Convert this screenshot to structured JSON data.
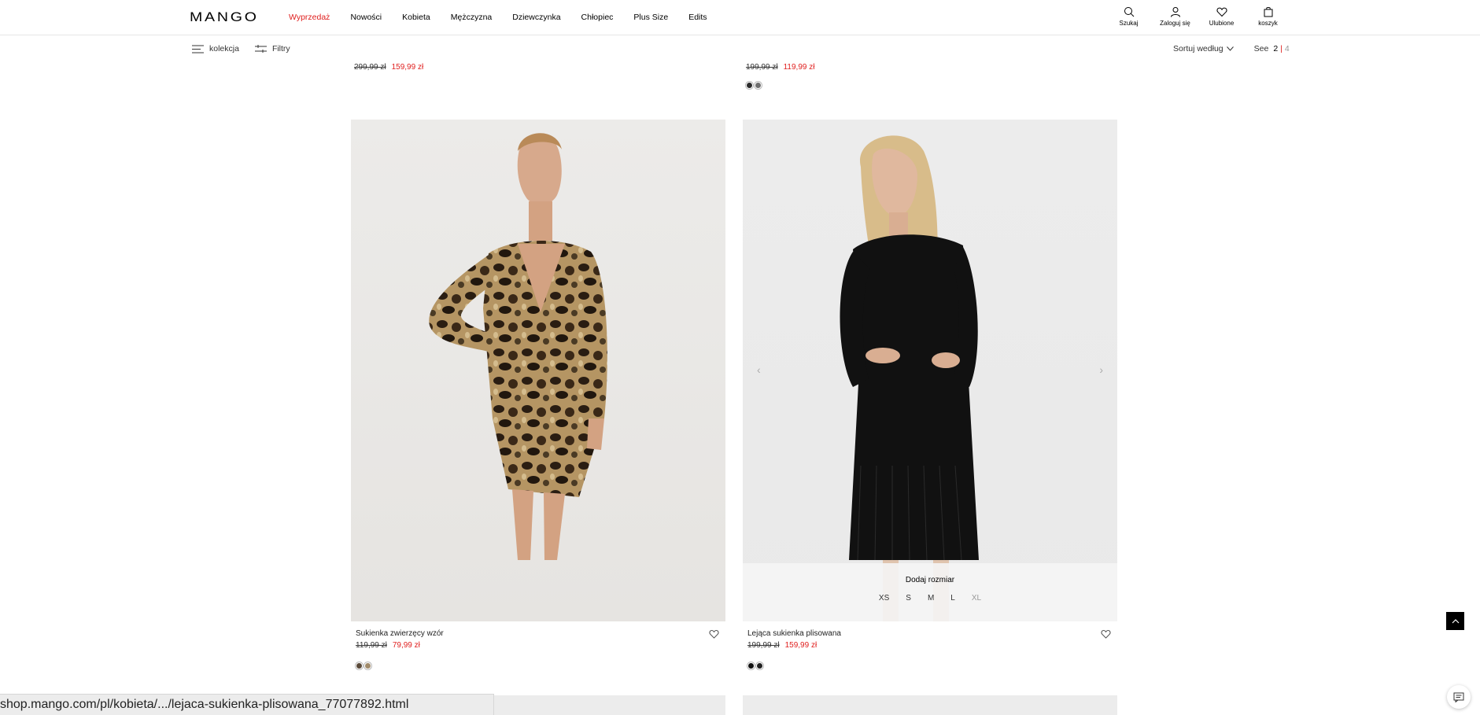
{
  "header": {
    "logo": "MANGO",
    "nav": [
      "Wyprzedaż",
      "Nowości",
      "Kobieta",
      "Mężczyzna",
      "Dziewczynka",
      "Chłopiec",
      "Plus Size",
      "Edits"
    ],
    "icons": {
      "search": "Szukaj",
      "login": "Zaloguj się",
      "favorites": "Ulubione",
      "cart": "koszyk"
    }
  },
  "toolbar": {
    "collection": "kolekcja",
    "filters": "Filtry",
    "sort": "Sortuj według",
    "see_label": "See",
    "see_option_2": "2",
    "see_separator": "|",
    "see_option_4": "4"
  },
  "top_row": [
    {
      "old_price": "299,99 zł",
      "new_price": "159,99 zł",
      "swatches": []
    },
    {
      "old_price": "199,99 zł",
      "new_price": "119,99 zł",
      "swatches": [
        "#2b2b2b",
        "#6e6e6e"
      ]
    }
  ],
  "products": [
    {
      "name": "Sukienka zwierzęcy wzór",
      "old_price": "119,99 zł",
      "new_price": "79,99 zł",
      "swatches": [
        "#5a4a3a",
        "#a08a6a"
      ]
    },
    {
      "name": "Lejąca sukienka plisowana",
      "old_price": "199,99 zł",
      "new_price": "159,99 zł",
      "swatches": [
        "#111111",
        "#222222"
      ],
      "size_panel": {
        "title": "Dodaj rozmiar",
        "sizes": [
          "XS",
          "S",
          "M",
          "L",
          "XL"
        ]
      }
    }
  ],
  "status_url": "shop.mango.com/pl/kobieta/.../lejaca-sukienka-plisowana_77077892.html",
  "colors": {
    "accent_red": "#e0201f"
  }
}
